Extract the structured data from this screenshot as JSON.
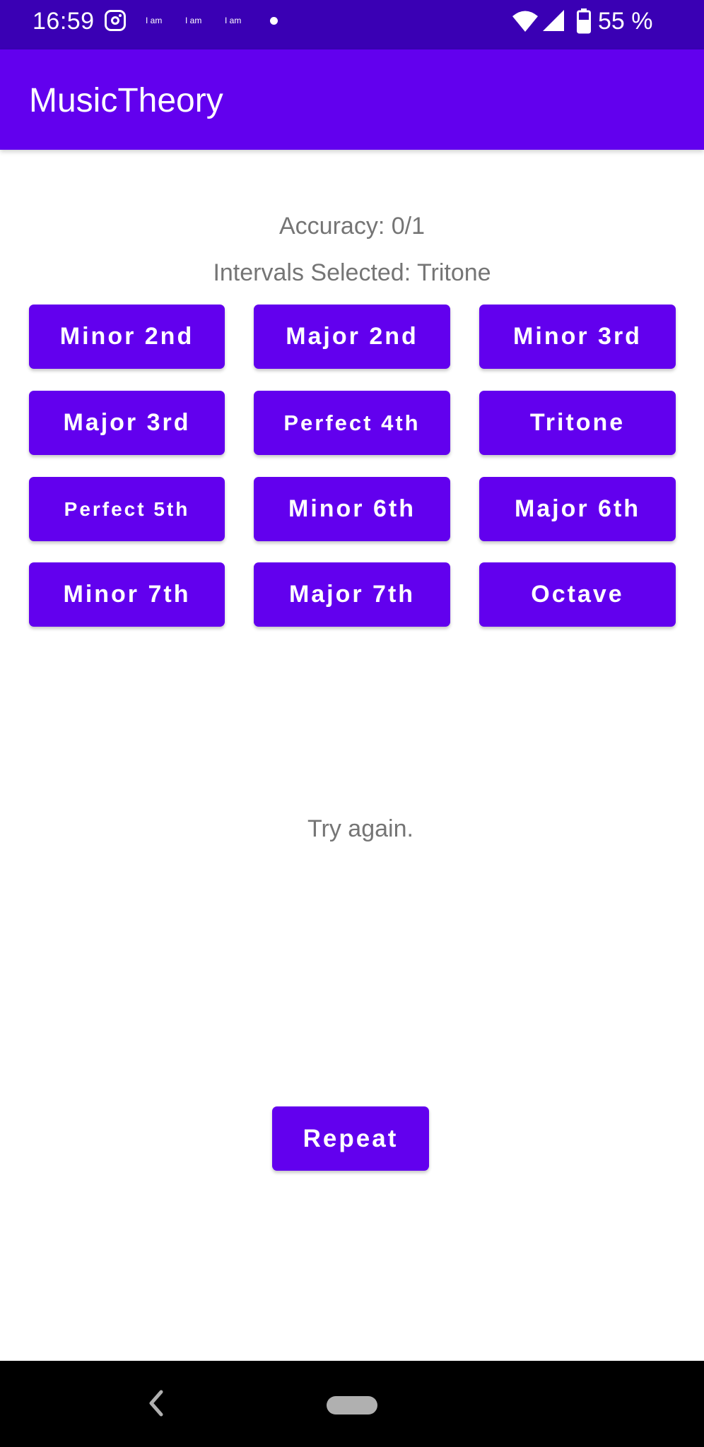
{
  "status_bar": {
    "time": "16:59",
    "notif_1": "I am",
    "notif_2": "I am",
    "notif_3": "I am",
    "battery": "55 %",
    "icons": [
      "instagram-icon",
      "wifi-icon",
      "signal-icon",
      "battery-icon"
    ]
  },
  "app_bar": {
    "title": "MusicTheory"
  },
  "main": {
    "accuracy": "Accuracy: 0/1",
    "intervals_selected": "Intervals Selected: Tritone",
    "buttons": [
      "Minor 2nd",
      "Major 2nd",
      "Minor 3rd",
      "Major 3rd",
      "Perfect 4th",
      "Tritone",
      "Perfect 5th",
      "Minor 6th",
      "Major 6th",
      "Minor 7th",
      "Major 7th",
      "Octave"
    ],
    "feedback": "Try again.",
    "repeat_label": "Repeat"
  },
  "colors": {
    "status_bar": "#3a00b4",
    "primary": "#6200ee",
    "secondary_text": "#757575"
  }
}
